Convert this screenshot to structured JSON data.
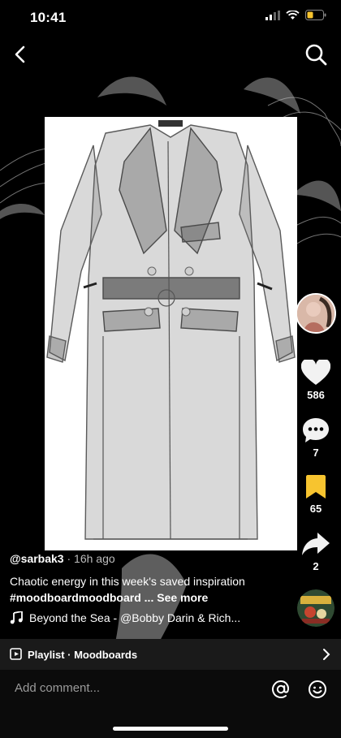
{
  "status": {
    "time": "10:41"
  },
  "nav": {
    "back_icon": "chevron-left-icon",
    "search_icon": "search-icon"
  },
  "post": {
    "username": "@sarbak3",
    "time_ago": " · 16h ago",
    "caption_text": "Chaotic energy in this week's saved inspiration",
    "hashtags": "#moodboardmoodboard",
    "ellipsis": " ... ",
    "see_more": "See more",
    "music": "Beyond the Sea - @Bobby Darin & Rich..."
  },
  "actions": {
    "likes": "586",
    "comments": "7",
    "saves": "65",
    "shares": "2"
  },
  "playlist": {
    "label": "Playlist · Moodboards"
  },
  "comment": {
    "placeholder": "Add comment..."
  },
  "colors": {
    "save_yellow": "#f7c42f",
    "background": "#000000"
  }
}
